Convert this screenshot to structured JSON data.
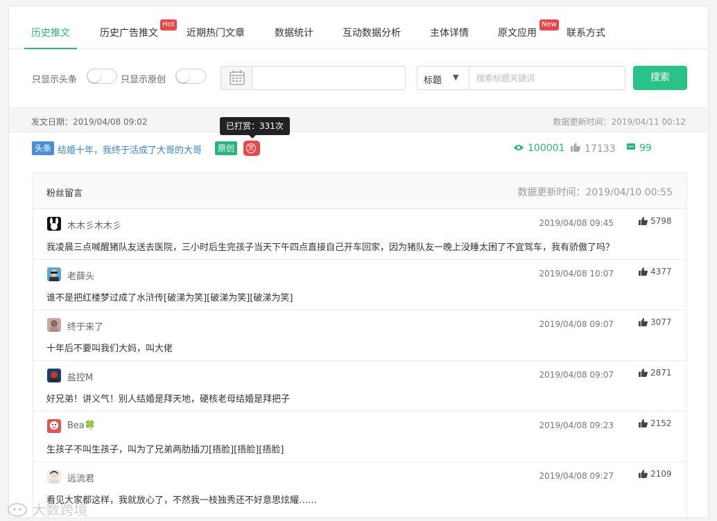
{
  "nav": {
    "tabs": [
      {
        "label": "历史推文"
      },
      {
        "label": "历史广告推文",
        "badge": "Hot"
      },
      {
        "label": "近期热门文章"
      },
      {
        "label": "数据统计"
      },
      {
        "label": "互动数据分析"
      },
      {
        "label": "主体详情"
      },
      {
        "label": "原文应用",
        "badge": "New"
      },
      {
        "label": "联系方式"
      }
    ]
  },
  "filter": {
    "headline_only": "只显示头条",
    "original_only": "只显示原创",
    "date_value": "",
    "select_value": "标题",
    "search_placeholder": "搜索标题关键词",
    "search_button": "搜索"
  },
  "post": {
    "date": "发文日期：2019/04/08 09:02",
    "updated": "数据更新时间：2019/04/11 00:12",
    "tooltip": "已打赏：331次",
    "tag_headline": "头条",
    "title": "结婚十年，我终于活成了大哥的大哥",
    "tag_original": "原创",
    "reward_icon": "赏",
    "views": "100001",
    "likes": "17133",
    "comments": "99"
  },
  "comments": {
    "title": "粉丝留言",
    "updated": "数据更新时间：2019/04/10 00:55",
    "items": [
      {
        "name": "木木彡木木彡",
        "time": "2019/04/08 09:45",
        "likes": "5798",
        "text": "我凌晨三点喊醒猪队友送去医院，三小时后生完孩子当天下午四点直接自己开车回家，因为猪队友一晚上没睡太困了不宜驾车，我有骄傲了吗？"
      },
      {
        "name": "老薛头",
        "time": "2019/04/08 10:07",
        "likes": "4377",
        "text": "谁不是把红楼梦过成了水浒传[破涕为笑][破涕为笑][破涕为笑]"
      },
      {
        "name": "终于来了",
        "time": "2019/04/08 09:07",
        "likes": "3077",
        "text": "十年后不要叫我们大妈，叫大佬"
      },
      {
        "name": "盐控M",
        "time": "2019/04/08 09:07",
        "likes": "2871",
        "text": "好兄弟！讲义气！别人结婚是拜天地，硬核老母结婚是拜把子"
      },
      {
        "name": "Bea🍀",
        "time": "2019/04/08 09:23",
        "likes": "2152",
        "text": "生孩子不叫生孩子，叫为了兄弟两肋插刀[捂脸][捂脸][捂脸]"
      },
      {
        "name": "远流君",
        "time": "2019/04/08 09:27",
        "likes": "2109",
        "text": "看见大家都这样，我就放心了，不然我一枝独秀还不好意思炫耀……"
      }
    ]
  },
  "watermark": "大数跨境",
  "colors": {
    "accent": "#2bb57b",
    "link": "#3a86c8",
    "badge": "#e8484a"
  }
}
